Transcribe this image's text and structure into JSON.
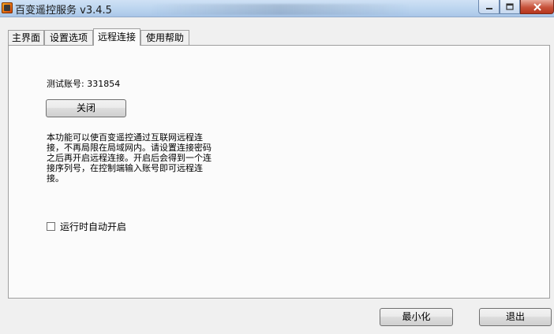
{
  "window": {
    "title": "百变遥控服务 v3.4.5"
  },
  "tabs": [
    {
      "label": "主界面"
    },
    {
      "label": "设置选项"
    },
    {
      "label": "远程连接",
      "active": true
    },
    {
      "label": "使用帮助"
    }
  ],
  "remote": {
    "account_label": "测试账号: 331854",
    "close_button": "关闭",
    "description": "本功能可以使百变遥控通过互联网远程连接，不再局限在局域网内。请设置连接密码之后再开启远程连接。开启后会得到一个连接序列号，在控制端输入账号即可远程连接。",
    "autostart_label": "运行时自动开启",
    "autostart_checked": false
  },
  "footer": {
    "minimize_button": "最小化",
    "exit_button": "退出"
  }
}
